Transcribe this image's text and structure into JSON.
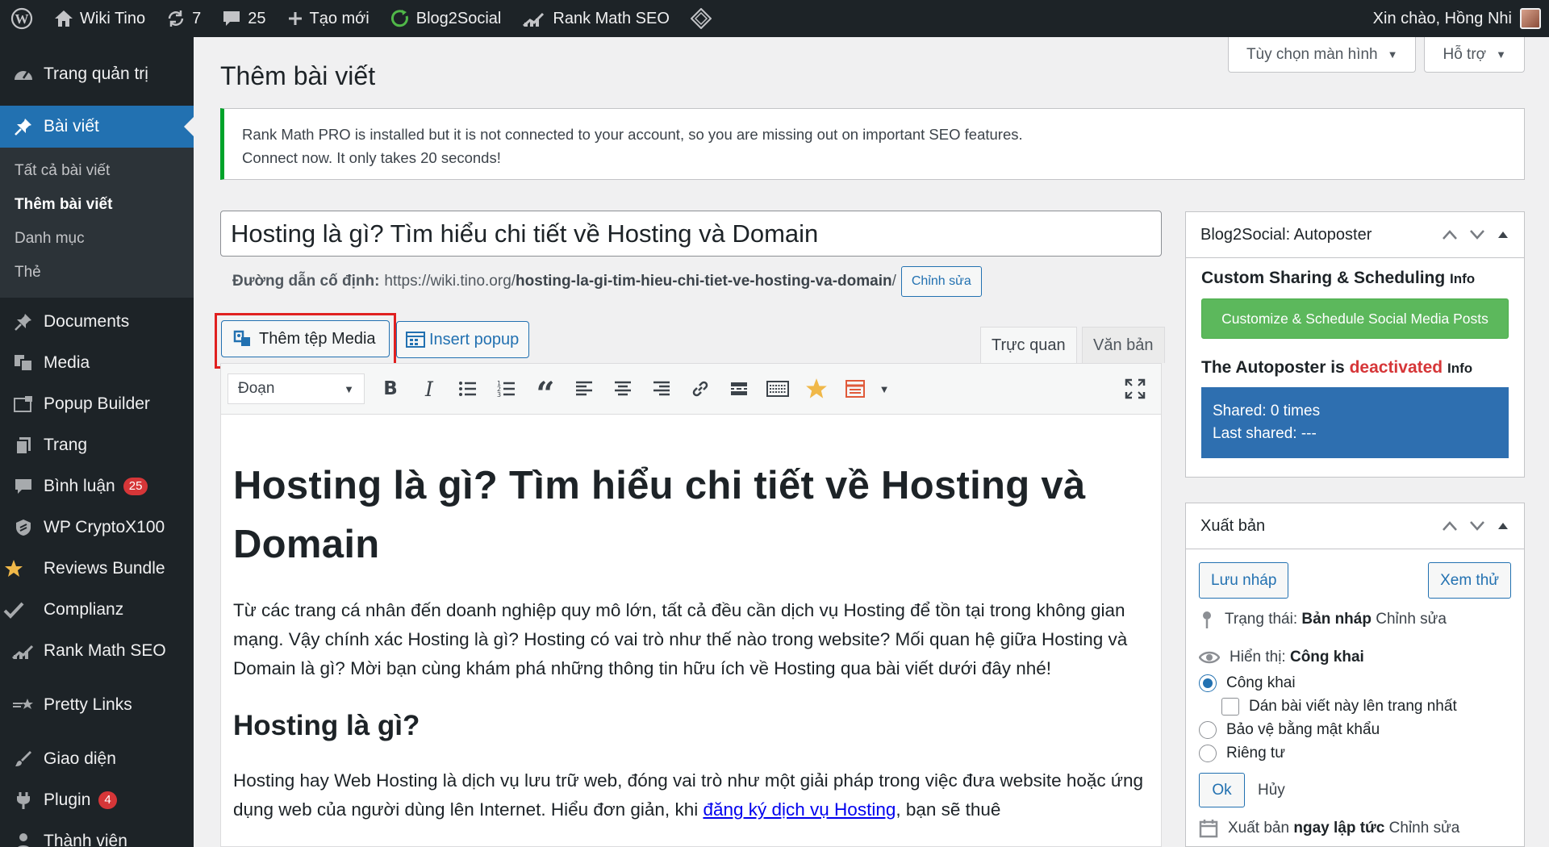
{
  "adminbar": {
    "site_name": "Wiki Tino",
    "updates_count": "7",
    "comments_count": "25",
    "new_label": "Tạo mới",
    "blog2social": "Blog2Social",
    "rank_math": "Rank Math SEO",
    "greeting": "Xin chào, Hồng Nhi"
  },
  "sidebar": {
    "dashboard": "Trang quản trị",
    "posts": "Bài viết",
    "submenu": [
      "Tất cả bài viết",
      "Thêm bài viết",
      "Danh mục",
      "Thẻ"
    ],
    "items": [
      {
        "label": "Documents",
        "icon": "pin-icon"
      },
      {
        "label": "Media",
        "icon": "media-icon"
      },
      {
        "label": "Popup Builder",
        "icon": "popup-icon"
      },
      {
        "label": "Trang",
        "icon": "page-icon"
      },
      {
        "label": "Bình luận",
        "icon": "comment-icon",
        "badge": "25"
      },
      {
        "label": "WP CryptoX100",
        "icon": "shield-icon"
      },
      {
        "label": "Reviews Bundle",
        "icon": "star-icon"
      },
      {
        "label": "Complianz",
        "icon": "check-icon"
      },
      {
        "label": "Rank Math SEO",
        "icon": "chart-icon"
      },
      {
        "label": "Pretty Links",
        "icon": "star-link-icon"
      },
      {
        "label": "Giao diện",
        "icon": "brush-icon"
      },
      {
        "label": "Plugin",
        "icon": "plugin-icon",
        "badge": "4"
      },
      {
        "label": "Thành viên",
        "icon": "user-icon"
      }
    ]
  },
  "screen_meta": {
    "screen_options": "Tùy chọn màn hình",
    "help": "Hỗ trợ"
  },
  "page_title": "Thêm bài viết",
  "notice": {
    "line1": "Rank Math PRO is installed but it is not connected to your account, so you are missing out on important SEO features.",
    "line2": "Connect now. It only takes 20 seconds!"
  },
  "post": {
    "title": "Hosting là gì? Tìm hiểu chi tiết về Hosting và Domain",
    "permalink_label": "Đường dẫn cố định:",
    "permalink_base": "https://wiki.tino.org/",
    "permalink_slug": "hosting-la-gi-tim-hieu-chi-tiet-ve-hosting-va-domain",
    "permalink_end": "/",
    "edit_slug": "Chỉnh sửa"
  },
  "editor": {
    "add_media": "Thêm tệp Media",
    "insert_popup": "Insert popup",
    "tab_visual": "Trực quan",
    "tab_text": "Văn bản",
    "format": "Đoạn",
    "h1": "Hosting là gì? Tìm hiểu chi tiết về Hosting và Domain",
    "p1": "Từ các trang cá nhân đến doanh nghiệp quy mô lớn, tất cả đều cần dịch vụ Hosting để tồn tại trong không gian mạng. Vậy chính xác Hosting là gì? Hosting có vai trò như thế nào trong website? Mối quan hệ giữa Hosting và Domain là gì? Mời bạn cùng khám phá những thông tin hữu ích về Hosting qua bài viết dưới đây nhé!",
    "h2": "Hosting là gì?",
    "p2_start": "Hosting hay Web Hosting là dịch vụ lưu trữ web, đóng vai trò như một giải pháp trong việc đưa website hoặc ứng dụng web của người dùng lên Internet. Hiểu đơn giản, khi ",
    "p2_link": "đăng ký dịch vụ Hosting",
    "p2_end": ", bạn sẽ thuê"
  },
  "b2s": {
    "title": "Blog2Social: Autoposter",
    "heading1": "Custom Sharing & Scheduling",
    "info": "Info",
    "button": "Customize & Schedule Social Media Posts",
    "heading2_pre": "The Autoposter is",
    "heading2_status": "deactivated",
    "shared": "Shared: 0 times",
    "last_shared": "Last shared: ---"
  },
  "publish": {
    "title": "Xuất bản",
    "save_draft": "Lưu nháp",
    "preview": "Xem thử",
    "status_label": "Trạng thái:",
    "status_value": "Bản nháp",
    "edit": "Chỉnh sửa",
    "visibility_label": "Hiển thị:",
    "visibility_value": "Công khai",
    "opt_public": "Công khai",
    "opt_sticky": "Dán bài viết này lên trang nhất",
    "opt_password": "Bảo vệ bằng mật khẩu",
    "opt_private": "Riêng tư",
    "ok": "Ok",
    "cancel": "Hủy",
    "schedule_label": "Xuất bản",
    "schedule_value": "ngay lập tức"
  }
}
